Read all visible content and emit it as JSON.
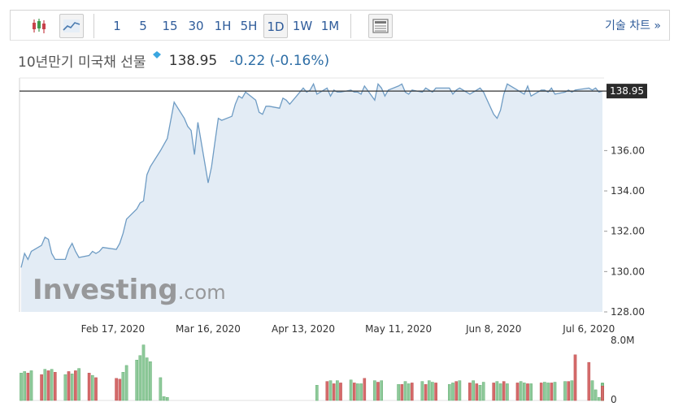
{
  "toolbar": {
    "candles_icon": "candlestick-chart-icon",
    "line_icon": "line-chart-icon",
    "periods": [
      "1",
      "5",
      "15",
      "30",
      "1H",
      "5H",
      "1D",
      "1W",
      "1M"
    ],
    "selected_period": "1D",
    "news_icon": "news-panel-icon",
    "tech_chart_label": "기술 차트 »"
  },
  "header": {
    "title": "10년만기 미국채 선물",
    "last": "138.95",
    "change": "-0.22 (-0.16%)"
  },
  "colors": {
    "line": "#6f9cc4",
    "area": "#e3ecf5",
    "price_line": "#333333",
    "vol_up": "#8ec99a",
    "vol_down": "#d46a6a",
    "link": "#2e5b9a"
  },
  "watermark": "Investing.com",
  "chart_data": {
    "type": "area",
    "ylim": [
      128,
      139.6
    ],
    "yticks": [
      "128.00",
      "130.00",
      "132.00",
      "134.00",
      "136.00"
    ],
    "last_price_label": "138.95",
    "last_price": 138.95,
    "xticks": [
      {
        "label": "Feb 17, 2020",
        "date": "2020-02-17"
      },
      {
        "label": "Mar 16, 2020",
        "date": "2020-03-16"
      },
      {
        "label": "Apr 13, 2020",
        "date": "2020-04-13"
      },
      {
        "label": "May 11, 2020",
        "date": "2020-05-11"
      },
      {
        "label": "Jun 8, 2020",
        "date": "2020-06-08"
      },
      {
        "label": "Jul 6, 2020",
        "date": "2020-07-06"
      }
    ],
    "series": [
      {
        "x": [
          "2020-01-21",
          "2020-01-22",
          "2020-01-23",
          "2020-01-24",
          "2020-01-27",
          "2020-01-28",
          "2020-01-29",
          "2020-01-30",
          "2020-01-31",
          "2020-02-03",
          "2020-02-04",
          "2020-02-05",
          "2020-02-06",
          "2020-02-07",
          "2020-02-10",
          "2020-02-11",
          "2020-02-12",
          "2020-02-13",
          "2020-02-14",
          "2020-02-18",
          "2020-02-19",
          "2020-02-20",
          "2020-02-21",
          "2020-02-24",
          "2020-02-25",
          "2020-02-26",
          "2020-02-27",
          "2020-02-28",
          "2020-03-02",
          "2020-03-03",
          "2020-03-04",
          "2020-03-05",
          "2020-03-06",
          "2020-03-09",
          "2020-03-10",
          "2020-03-11",
          "2020-03-12",
          "2020-03-13",
          "2020-03-16",
          "2020-03-17",
          "2020-03-18",
          "2020-03-19",
          "2020-03-20",
          "2020-03-23",
          "2020-03-24",
          "2020-03-25",
          "2020-03-26",
          "2020-03-27",
          "2020-03-30",
          "2020-03-31",
          "2020-04-01",
          "2020-04-02",
          "2020-04-03",
          "2020-04-06",
          "2020-04-07",
          "2020-04-08",
          "2020-04-09",
          "2020-04-13",
          "2020-04-14",
          "2020-04-15",
          "2020-04-16",
          "2020-04-17",
          "2020-04-20",
          "2020-04-21",
          "2020-04-22",
          "2020-04-23",
          "2020-04-24",
          "2020-04-27",
          "2020-04-28",
          "2020-04-29",
          "2020-04-30",
          "2020-05-01",
          "2020-05-04",
          "2020-05-05",
          "2020-05-06",
          "2020-05-07",
          "2020-05-08",
          "2020-05-11",
          "2020-05-12",
          "2020-05-13",
          "2020-05-14",
          "2020-05-15",
          "2020-05-18",
          "2020-05-19",
          "2020-05-20",
          "2020-05-21",
          "2020-05-22",
          "2020-05-26",
          "2020-05-27",
          "2020-05-28",
          "2020-05-29",
          "2020-06-01",
          "2020-06-02",
          "2020-06-03",
          "2020-06-04",
          "2020-06-05",
          "2020-06-08",
          "2020-06-09",
          "2020-06-10",
          "2020-06-11",
          "2020-06-12",
          "2020-06-15",
          "2020-06-16",
          "2020-06-17",
          "2020-06-18",
          "2020-06-19",
          "2020-06-22",
          "2020-06-23",
          "2020-06-24",
          "2020-06-25",
          "2020-06-26",
          "2020-06-29",
          "2020-06-30",
          "2020-07-01",
          "2020-07-02",
          "2020-07-06",
          "2020-07-07",
          "2020-07-08",
          "2020-07-09",
          "2020-07-10"
        ],
        "values": [
          130.2,
          130.9,
          130.6,
          131.0,
          131.3,
          131.7,
          131.6,
          130.9,
          130.6,
          130.6,
          131.1,
          131.4,
          131.0,
          130.7,
          130.8,
          131.0,
          130.9,
          131.0,
          131.2,
          131.1,
          131.4,
          131.9,
          132.6,
          133.1,
          133.4,
          133.5,
          134.8,
          135.2,
          136.0,
          136.3,
          136.6,
          137.5,
          138.4,
          137.6,
          137.2,
          137.0,
          135.8,
          137.4,
          134.4,
          135.2,
          136.4,
          137.6,
          137.5,
          137.7,
          138.3,
          138.7,
          138.6,
          138.9,
          138.5,
          137.9,
          137.8,
          138.2,
          138.2,
          138.1,
          138.6,
          138.5,
          138.3,
          139.1,
          138.9,
          139.0,
          139.3,
          138.8,
          139.1,
          138.7,
          139.0,
          138.9,
          138.9,
          139.0,
          138.9,
          138.9,
          138.8,
          139.2,
          138.5,
          139.3,
          139.1,
          138.7,
          139.0,
          139.2,
          139.3,
          138.9,
          138.8,
          139.0,
          138.9,
          139.1,
          139.0,
          138.9,
          139.1,
          139.1,
          138.8,
          139.0,
          139.1,
          138.8,
          138.9,
          139.0,
          139.1,
          138.9,
          137.8,
          137.6,
          138.0,
          138.8,
          139.3,
          139.0,
          138.9,
          138.8,
          139.2,
          138.7,
          139.0,
          139.0,
          138.9,
          139.1,
          138.8,
          138.9,
          139.0,
          138.9,
          139.0,
          139.1,
          139.0,
          139.1,
          138.9,
          138.95
        ]
      }
    ],
    "volume": {
      "max_label": "8.0M",
      "min_label": "0",
      "ylim": [
        0,
        8.0
      ],
      "values": [
        3.6,
        3.8,
        3.6,
        3.9,
        3.4,
        4.1,
        3.9,
        4.1,
        3.7,
        3.4,
        3.8,
        3.5,
        3.9,
        4.2,
        3.6,
        3.3,
        3.0,
        0,
        0,
        2.9,
        2.8,
        3.7,
        4.6,
        5.3,
        5.9,
        7.3,
        5.6,
        5.1,
        3.0,
        0.5,
        0.4,
        0,
        0,
        0,
        0,
        0,
        0,
        0,
        0,
        0,
        0,
        0,
        0,
        0,
        0,
        0,
        0,
        0,
        0,
        0,
        0,
        0,
        0,
        0,
        0,
        0,
        0,
        0,
        0,
        0,
        0,
        2.0,
        2.5,
        2.6,
        2.2,
        2.6,
        2.3,
        2.7,
        2.3,
        2.2,
        2.2,
        2.9,
        2.6,
        2.4,
        2.6,
        0,
        0,
        2.1,
        2.1,
        2.5,
        2.2,
        2.3,
        2.5,
        2.1,
        2.6,
        2.4,
        2.3,
        2.1,
        2.3,
        2.5,
        2.6,
        2.3,
        2.6,
        2.2,
        2.0,
        2.4,
        2.3,
        2.5,
        2.2,
        2.5,
        2.2,
        2.3,
        2.5,
        2.3,
        2.2,
        2.2,
        2.3,
        2.4,
        2.3,
        2.3,
        2.4,
        2.5,
        2.5,
        2.6,
        6.0,
        5.0,
        2.6,
        1.4,
        0.4,
        0,
        1.8,
        2.0,
        2.3,
        2.2,
        2.0,
        2.2,
        2.1,
        2.0,
        2.2,
        1.9
      ],
      "up": [
        1,
        1,
        0,
        1,
        0,
        1,
        0,
        1,
        0,
        1,
        0,
        1,
        0,
        1,
        0,
        1,
        0,
        0,
        0,
        0,
        0,
        1,
        1,
        1,
        1,
        1,
        1,
        1,
        1,
        1,
        1,
        0,
        0,
        0,
        0,
        0,
        0,
        0,
        0,
        0,
        0,
        0,
        0,
        0,
        0,
        0,
        0,
        0,
        0,
        0,
        0,
        0,
        0,
        0,
        0,
        0,
        0,
        0,
        0,
        0,
        0,
        1,
        0,
        1,
        0,
        1,
        0,
        1,
        0,
        1,
        1,
        0,
        1,
        0,
        1,
        0,
        0,
        1,
        0,
        1,
        1,
        0,
        1,
        0,
        1,
        1,
        0,
        1,
        1,
        0,
        1,
        0,
        1,
        0,
        1,
        1,
        0,
        1,
        1,
        0,
        1,
        0,
        1,
        1,
        0,
        1,
        0,
        1,
        1,
        0,
        1,
        1,
        0,
        1,
        0,
        0,
        1,
        1,
        1,
        0,
        1,
        0,
        1,
        1,
        0,
        1,
        1,
        0,
        1,
        0
      ]
    }
  }
}
